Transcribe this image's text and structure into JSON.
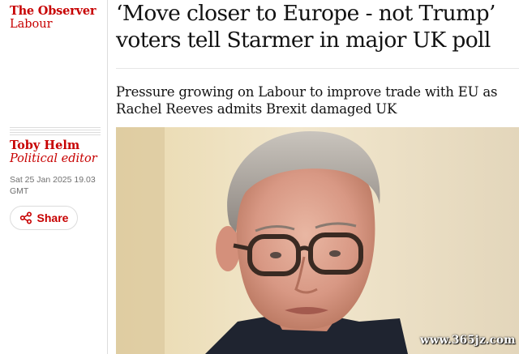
{
  "publication": "The Observer",
  "section": "Labour",
  "byline": {
    "name": "Toby Helm",
    "role": "Political editor"
  },
  "dateline": {
    "date": "Sat 25 Jan 2025 19.03",
    "timezone": "GMT"
  },
  "share": {
    "label": "Share",
    "icon": "share-icon"
  },
  "headline": {
    "line1": "‘Move closer to Europe - not Trump’",
    "line2": "voters tell Starmer in major UK poll"
  },
  "standfirst": {
    "line1": "Pressure growing on Labour to improve trade with EU as",
    "line2": "Rachel Reeves admits Brexit damaged UK"
  },
  "watermark": "www.365jz.com",
  "colors": {
    "accent": "#c70000",
    "text": "#121212",
    "meta": "#707070"
  }
}
